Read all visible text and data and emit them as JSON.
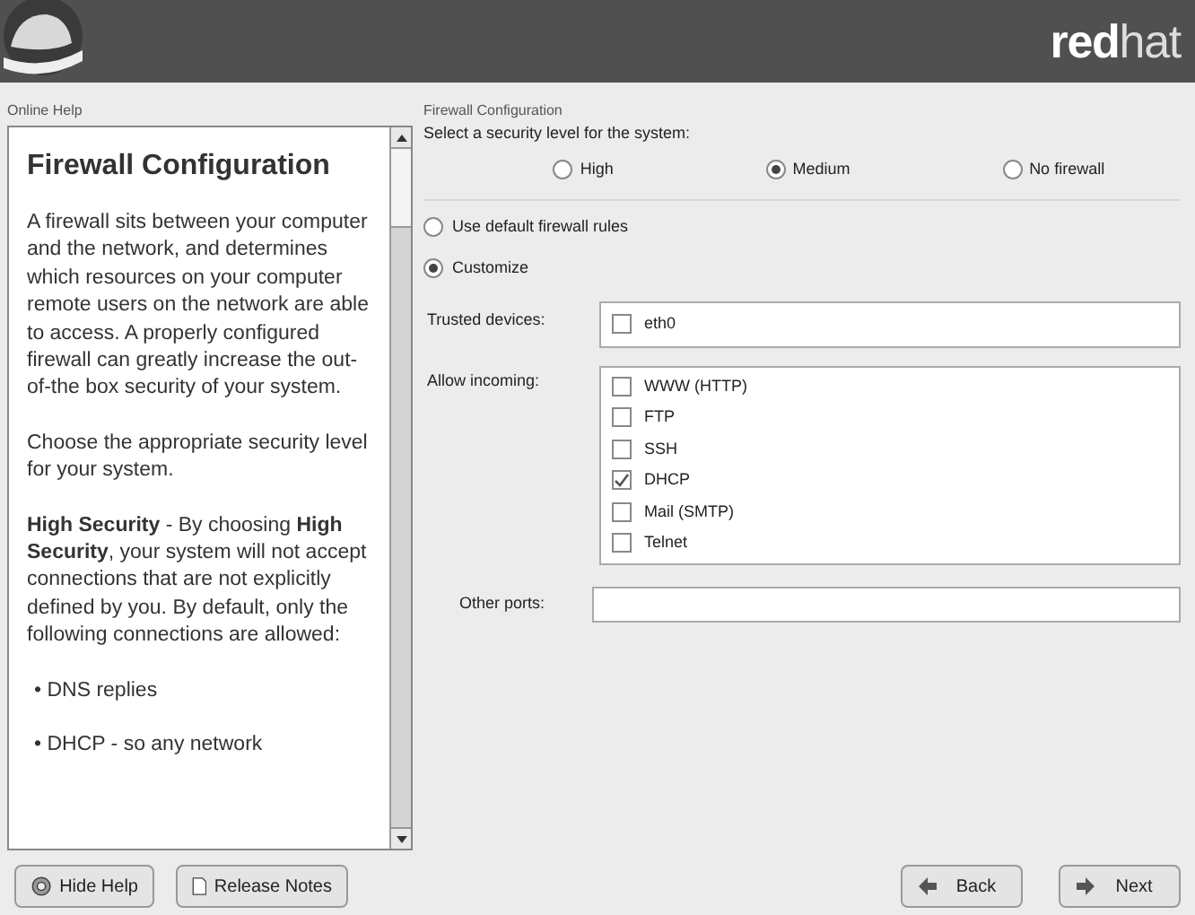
{
  "header": {
    "brand_bold": "red",
    "brand_light": "hat"
  },
  "help": {
    "label": "Online Help",
    "title": "Firewall Configuration",
    "paragraphs": [
      "A firewall sits between your computer and the network, and determines which resources on your computer remote users on the network are able to access. A properly configured firewall can greatly increase the out-of-the box security of your system.",
      "Choose the appropriate security level for your system.",
      "**High Security** - By choosing **High Security**, your system will not accept connections that are not explicitly defined by you. By default, only the following connections are allowed:"
    ],
    "bullets": [
      "• DNS replies",
      "• DHCP - so any network"
    ]
  },
  "panel": {
    "label": "Firewall Configuration",
    "prompt": "Select a security level for the system:",
    "levels": [
      {
        "label": "High",
        "selected": false
      },
      {
        "label": "Medium",
        "selected": true
      },
      {
        "label": "No firewall",
        "selected": false
      }
    ],
    "rules": [
      {
        "label": "Use default firewall rules",
        "selected": false
      },
      {
        "label": "Customize",
        "selected": true
      }
    ],
    "trusted_label": "Trusted devices:",
    "trusted": [
      {
        "label": "eth0",
        "checked": false
      }
    ],
    "incoming_label": "Allow incoming:",
    "incoming": [
      {
        "label": "WWW (HTTP)",
        "checked": false
      },
      {
        "label": "FTP",
        "checked": false
      },
      {
        "label": "SSH",
        "checked": false
      },
      {
        "label": "DHCP",
        "checked": true
      },
      {
        "label": "Mail (SMTP)",
        "checked": false
      },
      {
        "label": "Telnet",
        "checked": false
      }
    ],
    "ports_label": "Other ports:"
  },
  "buttons": {
    "left": [
      {
        "label": "Hide Help",
        "kind": "help"
      },
      {
        "label": "Release Notes",
        "kind": "notes"
      }
    ],
    "right": [
      {
        "label": "Back",
        "kind": "back"
      },
      {
        "label": "Next",
        "kind": "next"
      }
    ]
  }
}
